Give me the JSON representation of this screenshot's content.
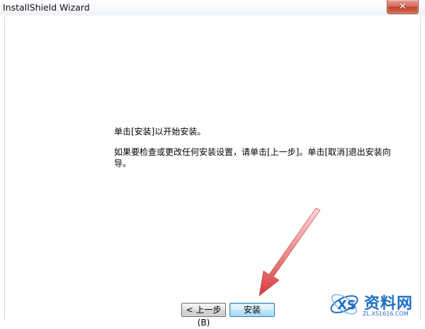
{
  "window": {
    "title": "InstallShield Wizard",
    "close_icon": "✕"
  },
  "content": {
    "line1": "单击[安装]以开始安装。",
    "line2": "如果要检查或更改任何安装设置，请单击[上一步]。单击[取消]退出安装向导。"
  },
  "buttons": {
    "back_label": "< 上一步(B)",
    "install_label": "安装"
  },
  "watermark": {
    "text": "资料网",
    "url": "ZL.XS1616.COM"
  },
  "icons": [
    "close-icon",
    "annotation-arrow",
    "watermark-logo-icon"
  ],
  "colors": {
    "arrow": "#d9393a",
    "close_button": "#c4412f",
    "watermark": "#1f6fc4"
  }
}
